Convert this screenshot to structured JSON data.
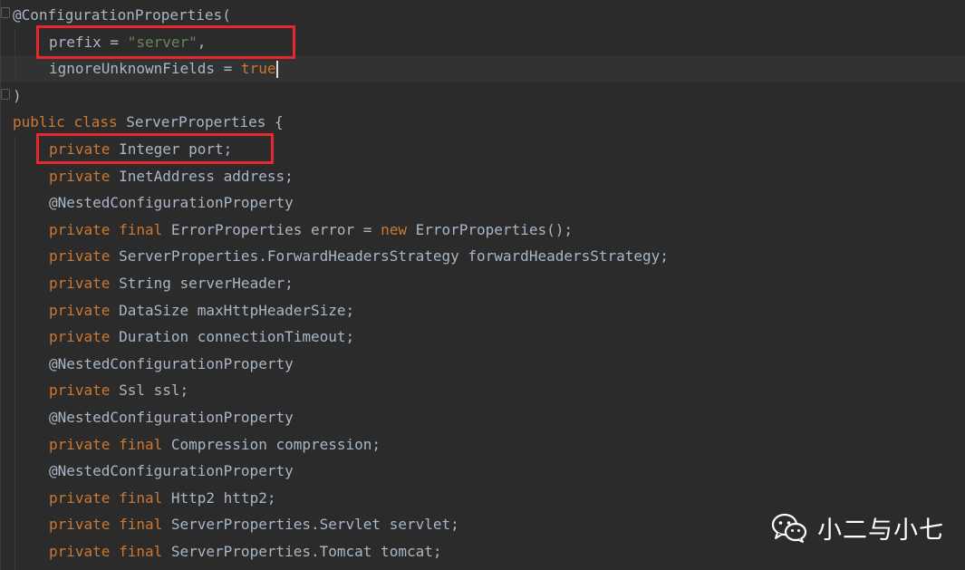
{
  "code": {
    "annotation_name": "@ConfigurationProperties(",
    "prefix_key": "prefix = ",
    "prefix_value": "\"server\"",
    "prefix_comma": ",",
    "ignore_key": "ignoreUnknownFields = ",
    "ignore_value": "true",
    "close_paren": ")",
    "class_public": "public",
    "class_kw": "class",
    "class_decl": " ServerProperties {",
    "lines": [
      {
        "mods": "private",
        "rest": " Integer port;"
      },
      {
        "mods": "private",
        "rest": " InetAddress address;"
      },
      {
        "ann": "@NestedConfigurationProperty"
      },
      {
        "mods": "private final",
        "rest": " ErrorProperties error = ",
        "kw2": "new",
        "rest2": " ErrorProperties();"
      },
      {
        "mods": "private",
        "rest": " ServerProperties.ForwardHeadersStrategy forwardHeadersStrategy;"
      },
      {
        "mods": "private",
        "rest": " String serverHeader;"
      },
      {
        "mods": "private",
        "rest": " DataSize maxHttpHeaderSize;"
      },
      {
        "mods": "private",
        "rest": " Duration connectionTimeout;"
      },
      {
        "ann": "@NestedConfigurationProperty"
      },
      {
        "mods": "private",
        "rest": " Ssl ssl;"
      },
      {
        "ann": "@NestedConfigurationProperty"
      },
      {
        "mods": "private final",
        "rest": " Compression compression;"
      },
      {
        "ann": "@NestedConfigurationProperty"
      },
      {
        "mods": "private final",
        "rest": " Http2 http2;"
      },
      {
        "mods": "private final",
        "rest": " ServerProperties.Servlet servlet;"
      },
      {
        "mods": "private final",
        "rest": " ServerProperties.Tomcat tomcat;"
      }
    ]
  },
  "colors": {
    "background": "#2b2b2b",
    "keyword": "#cc7832",
    "annotation": "#bbb529",
    "string": "#6a8759",
    "text": "#a9b7c6",
    "highlight_box": "#e8262d"
  },
  "watermark": {
    "icon": "wechat-icon",
    "text": "小二与小七"
  }
}
